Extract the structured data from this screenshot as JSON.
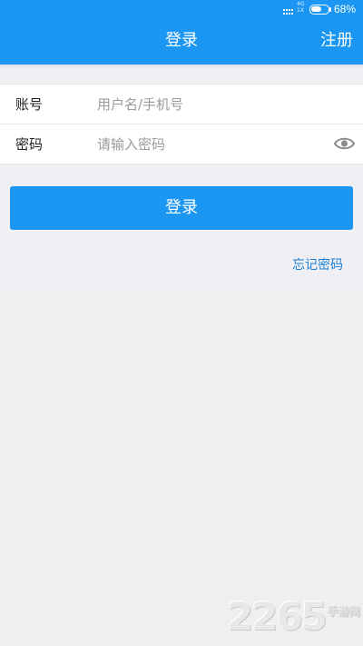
{
  "status_bar": {
    "network_label": "4G",
    "network_sub": "1X",
    "battery_percent_text": "68%",
    "battery_level": 0.68
  },
  "header": {
    "title": "登录",
    "register_label": "注册"
  },
  "form": {
    "account": {
      "label": "账号",
      "placeholder": "用户名/手机号",
      "value": ""
    },
    "password": {
      "label": "密码",
      "placeholder": "请输入密码",
      "value": ""
    }
  },
  "actions": {
    "login_label": "登录",
    "forgot_label": "忘记密码"
  },
  "watermark": {
    "number": "2265",
    "text": "手游网"
  },
  "colors": {
    "brand_blue": "#1b97f3",
    "link_blue": "#1b7fd3",
    "background": "#efeff4"
  }
}
